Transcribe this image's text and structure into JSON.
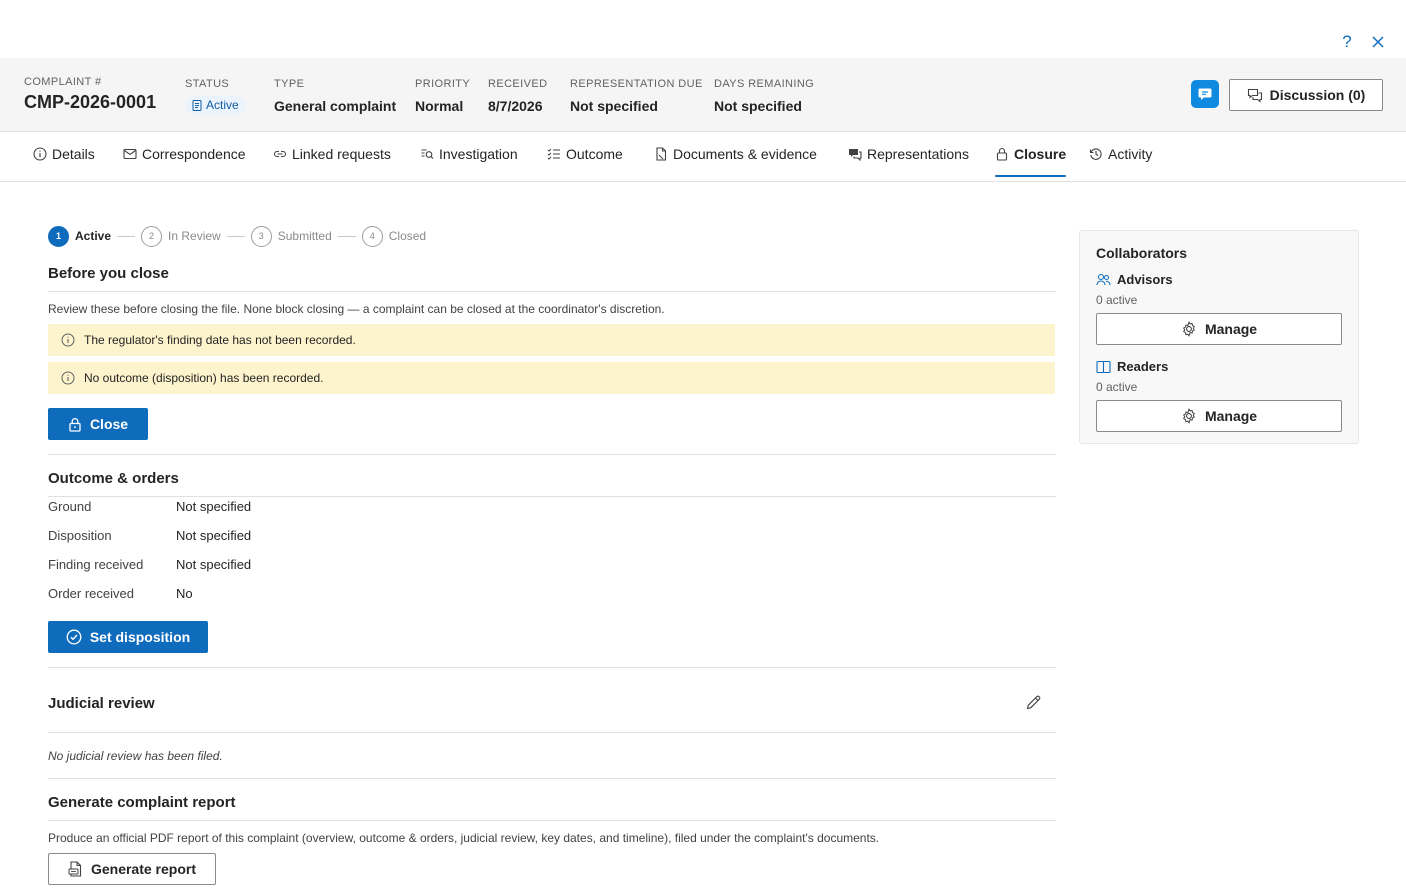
{
  "window": {
    "help_icon": "question-icon",
    "close_icon": "close-icon"
  },
  "header": {
    "complaint_label": "COMPLAINT #",
    "complaint_number": "CMP-2026-0001",
    "status_label": "STATUS",
    "status_value": "Active",
    "type_label": "TYPE",
    "type_value": "General complaint",
    "priority_label": "PRIORITY",
    "priority_value": "Normal",
    "received_label": "RECEIVED",
    "received_value": "8/7/2026",
    "rep_due_label": "REPRESENTATION DUE",
    "rep_due_value": "Not specified",
    "days_remaining_label": "DAYS REMAINING",
    "days_remaining_value": "Not specified",
    "discussion_label": "Discussion (0)"
  },
  "tabs": [
    {
      "label": "Details",
      "icon": "info-icon"
    },
    {
      "label": "Correspondence",
      "icon": "mail-icon"
    },
    {
      "label": "Linked requests",
      "icon": "link-icon"
    },
    {
      "label": "Investigation",
      "icon": "investigation-icon"
    },
    {
      "label": "Outcome",
      "icon": "checklist-icon"
    },
    {
      "label": "Documents & evidence",
      "icon": "document-icon"
    },
    {
      "label": "Representations",
      "icon": "chat-icon"
    },
    {
      "label": "Closure",
      "icon": "lock-icon",
      "active": true
    },
    {
      "label": "Activity",
      "icon": "history-icon"
    }
  ],
  "stepper": [
    {
      "number": "1",
      "label": "Active",
      "current": true
    },
    {
      "number": "2",
      "label": "In Review"
    },
    {
      "number": "3",
      "label": "Submitted"
    },
    {
      "number": "4",
      "label": "Closed"
    }
  ],
  "before_close": {
    "title": "Before you close",
    "description": "Review these before closing the file. None block closing — a complaint can be closed at the coordinator's discretion.",
    "warnings": [
      "The regulator's finding date has not been recorded.",
      "No outcome (disposition) has been recorded."
    ],
    "close_button": "Close"
  },
  "outcome": {
    "title": "Outcome & orders",
    "rows": [
      {
        "label": "Ground",
        "value": "Not specified"
      },
      {
        "label": "Disposition",
        "value": "Not specified"
      },
      {
        "label": "Finding received",
        "value": "Not specified"
      },
      {
        "label": "Order received",
        "value": "No"
      }
    ],
    "set_disposition_button": "Set disposition"
  },
  "judicial_review": {
    "title": "Judicial review",
    "empty_text": "No judicial review has been filed."
  },
  "report": {
    "title": "Generate complaint report",
    "description": "Produce an official PDF report of this complaint (overview, outcome & orders, judicial review, key dates, and timeline), filed under the complaint's documents.",
    "button": "Generate report"
  },
  "collaborators": {
    "title": "Collaborators",
    "advisors_label": "Advisors",
    "advisors_count": "0 active",
    "readers_label": "Readers",
    "readers_count": "0 active",
    "manage_label": "Manage"
  },
  "colors": {
    "accent": "#0f6cbd",
    "warning_bg": "#fdf3cd",
    "header_bg": "#f5f5f5"
  }
}
